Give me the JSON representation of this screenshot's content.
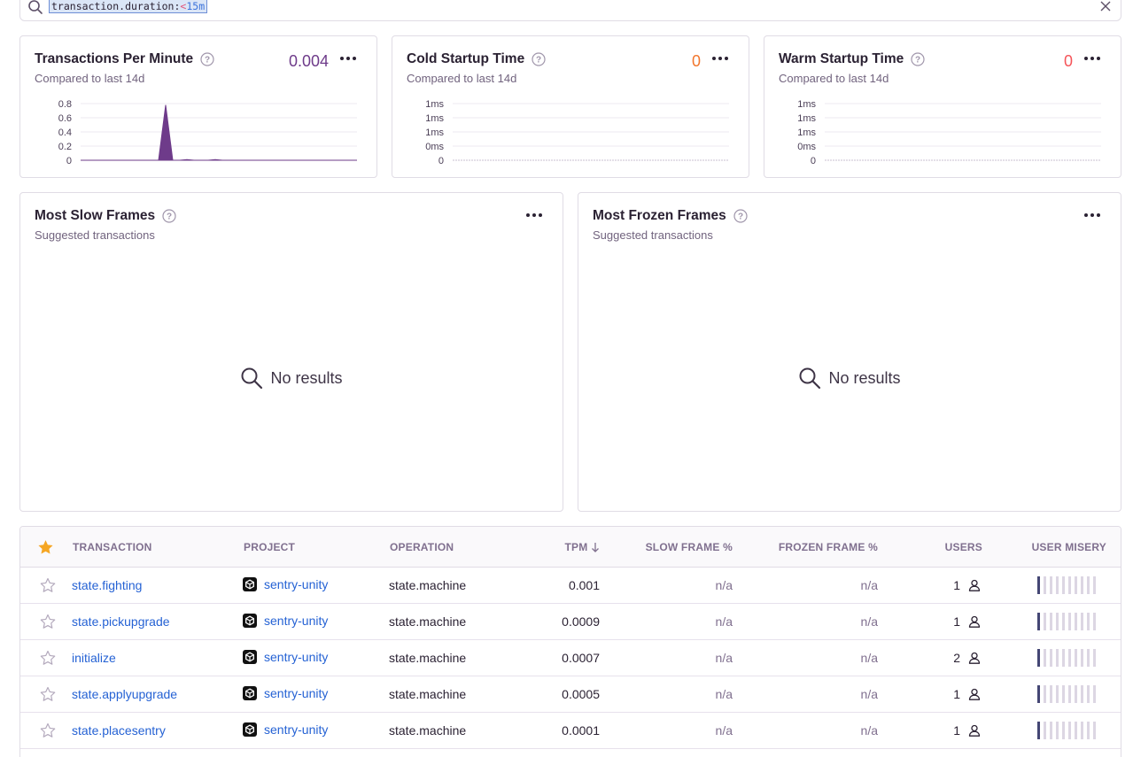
{
  "search": {
    "key": "transaction.duration:",
    "operator": "<",
    "value": "15m"
  },
  "widgets": [
    {
      "title": "Transactions Per Minute",
      "subtitle": "Compared to last 14d",
      "value": "0.004",
      "value_color": "#6c5fc7",
      "y_ticks": [
        "0.8",
        "0.6",
        "0.4",
        "0.2",
        "0"
      ],
      "series_color": "#6e3b8a"
    },
    {
      "title": "Cold Startup Time",
      "subtitle": "Compared to last 14d",
      "value": "0",
      "value_color": "#f2762c",
      "y_ticks": [
        "1ms",
        "1ms",
        "1ms",
        "0ms",
        "0"
      ]
    },
    {
      "title": "Warm Startup Time",
      "subtitle": "Compared to last 14d",
      "value": "0",
      "value_color": "#f55459",
      "y_ticks": [
        "1ms",
        "1ms",
        "1ms",
        "0ms",
        "0"
      ]
    }
  ],
  "chart_data": {
    "type": "area",
    "title": "Transactions Per Minute",
    "y_ticks": [
      "0",
      "0.2",
      "0.4",
      "0.6",
      "0.8"
    ],
    "ylim": [
      0,
      0.8
    ],
    "note": "single spike near start of range",
    "values": [
      0,
      0,
      0,
      0,
      0,
      0,
      0,
      0,
      0,
      0,
      0,
      0,
      0.78,
      0,
      0,
      0.01,
      0,
      0,
      0,
      0.01,
      0,
      0,
      0,
      0,
      0,
      0,
      0,
      0,
      0,
      0,
      0,
      0,
      0,
      0,
      0,
      0,
      0,
      0,
      0,
      0
    ]
  },
  "panels": [
    {
      "title": "Most Slow Frames",
      "subtitle": "Suggested transactions",
      "empty": "No results"
    },
    {
      "title": "Most Frozen Frames",
      "subtitle": "Suggested transactions",
      "empty": "No results"
    }
  ],
  "table": {
    "columns": {
      "transaction": "TRANSACTION",
      "project": "PROJECT",
      "operation": "OPERATION",
      "tpm": "TPM",
      "slow": "SLOW FRAME %",
      "frozen": "FROZEN FRAME %",
      "users": "USERS",
      "misery": "USER MISERY"
    },
    "rows": [
      {
        "transaction": "state.fighting",
        "project": "sentry-unity",
        "operation": "state.machine",
        "tpm": "0.001",
        "slow": "n/a",
        "frozen": "n/a",
        "users": "1"
      },
      {
        "transaction": "state.pickupgrade",
        "project": "sentry-unity",
        "operation": "state.machine",
        "tpm": "0.0009",
        "slow": "n/a",
        "frozen": "n/a",
        "users": "1"
      },
      {
        "transaction": "initialize",
        "project": "sentry-unity",
        "operation": "state.machine",
        "tpm": "0.0007",
        "slow": "n/a",
        "frozen": "n/a",
        "users": "2"
      },
      {
        "transaction": "state.applyupgrade",
        "project": "sentry-unity",
        "operation": "state.machine",
        "tpm": "0.0005",
        "slow": "n/a",
        "frozen": "n/a",
        "users": "1"
      },
      {
        "transaction": "state.placesentry",
        "project": "sentry-unity",
        "operation": "state.machine",
        "tpm": "0.0001",
        "slow": "n/a",
        "frozen": "n/a",
        "users": "1"
      }
    ],
    "misery_level": 1
  },
  "colors": {
    "accent": "#6c5fc7",
    "link": "#2562d4",
    "star_active": "#f5a623"
  }
}
